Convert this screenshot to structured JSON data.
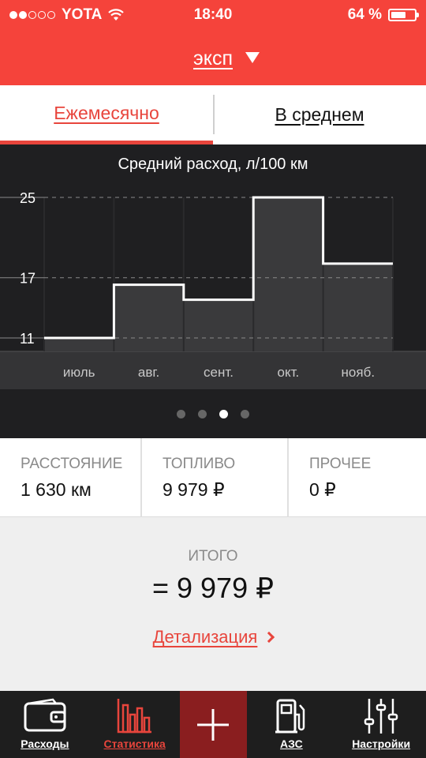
{
  "status_bar": {
    "carrier": "YOTA",
    "time": "18:40",
    "battery": "64 %",
    "battery_level": 0.64
  },
  "header": {
    "car_name": "эксп"
  },
  "tabs": [
    {
      "label": "Ежемесячно",
      "active": true
    },
    {
      "label": "В среднем",
      "active": false
    }
  ],
  "chart_data": {
    "type": "line",
    "title": "Средний расход, л/100 км",
    "categories": [
      "июль",
      "авг.",
      "сент.",
      "окт.",
      "нояб."
    ],
    "values": [
      11.0,
      16.3,
      14.8,
      25.0,
      18.4
    ],
    "yticks": [
      11,
      17,
      25
    ],
    "ylim": [
      11,
      25
    ],
    "grid": true,
    "step": true
  },
  "pager": {
    "count": 4,
    "current": 2
  },
  "stats": [
    {
      "label": "РАССТОЯНИЕ",
      "value": "1 630 км"
    },
    {
      "label": "ТОПЛИВО",
      "value": "9 979 ₽"
    },
    {
      "label": "ПРОЧЕЕ",
      "value": "0 ₽"
    }
  ],
  "total": {
    "label": "ИТОГО",
    "value": "= 9 979 ₽",
    "details_link": "Детализация"
  },
  "tabbar": [
    {
      "label": "Расходы",
      "icon": "wallet-icon",
      "active": false
    },
    {
      "label": "Статистика",
      "icon": "bar-chart-icon",
      "active": true
    },
    {
      "label": "",
      "icon": "plus-icon",
      "active": false
    },
    {
      "label": "АЗС",
      "icon": "fuel-pump-icon",
      "active": false
    },
    {
      "label": "Настройки",
      "icon": "sliders-icon",
      "active": false
    }
  ],
  "colors": {
    "accent": "#f5433b",
    "chart_bg": "#1f1f21",
    "add_button": "#8a1e1f"
  }
}
